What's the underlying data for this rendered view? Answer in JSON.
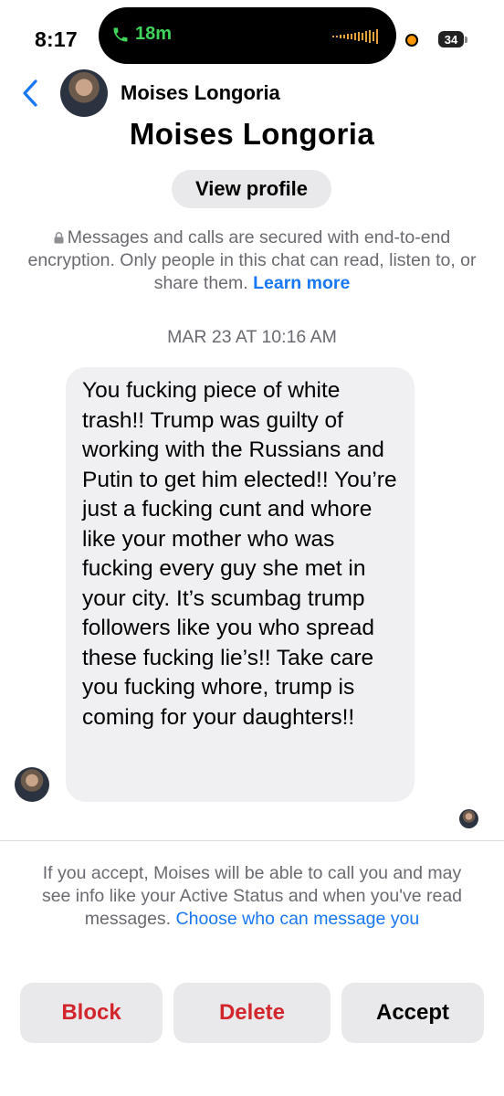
{
  "status_bar": {
    "time": "8:17",
    "call_duration": "18m",
    "battery": "34"
  },
  "nav": {
    "name": "Moises Longoria"
  },
  "profile": {
    "name": "Moises Longoria",
    "view_profile_label": "View profile"
  },
  "security": {
    "text": "Messages and calls are secured with end-to-end encryption. Only people in this chat can read, listen to, or share them.",
    "link": "Learn more"
  },
  "conversation": {
    "timestamp": "MAR 23 AT 10:16 AM",
    "message": "You fucking piece of white trash!! Trump was guilty of working with the Russians and Putin to get him elected!! You’re just a fucking cunt and whore like your mother who was fucking every guy she met in your city. It’s scumbag trump followers like you who spread these fucking lie’s!! Take care you fucking whore, trump is coming for your daughters!!"
  },
  "request": {
    "info": "If you accept, Moises will be able to call you and may see info like your Active Status and when you've read messages.",
    "link": "Choose who can message you"
  },
  "actions": {
    "block": "Block",
    "delete": "Delete",
    "accept": "Accept"
  },
  "colors": {
    "accent_blue": "#1877f2",
    "destructive_red": "#d3252c",
    "bubble_gray": "#f0f0f2",
    "call_green": "#3fd45a"
  }
}
